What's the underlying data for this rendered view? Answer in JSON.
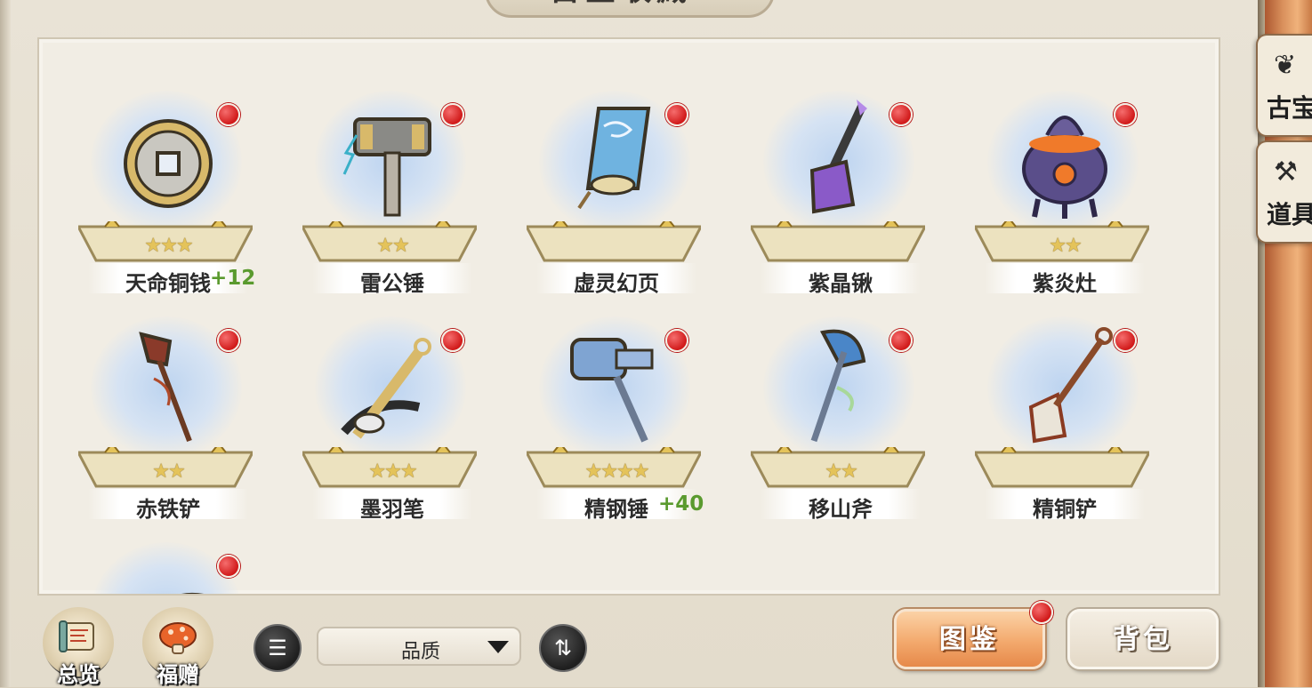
{
  "header": {
    "title": "古宝收藏"
  },
  "side_tabs": [
    {
      "label": "古宝",
      "icon": "scroll-icon"
    },
    {
      "label": "道具",
      "icon": "tool-icon"
    }
  ],
  "items": [
    {
      "name": "天命铜钱",
      "stars": 3,
      "bonus": "+12",
      "icon": "copper-coin-icon"
    },
    {
      "name": "雷公锤",
      "stars": 2,
      "bonus": "",
      "icon": "thunder-hammer-icon"
    },
    {
      "name": "虚灵幻页",
      "stars": 0,
      "bonus": "",
      "icon": "spirit-scroll-icon"
    },
    {
      "name": "紫晶锹",
      "stars": 0,
      "bonus": "",
      "icon": "amethyst-spade-icon"
    },
    {
      "name": "紫炎灶",
      "stars": 2,
      "bonus": "",
      "icon": "purple-stove-icon"
    },
    {
      "name": "赤铁铲",
      "stars": 2,
      "bonus": "",
      "icon": "red-iron-shovel-icon"
    },
    {
      "name": "墨羽笔",
      "stars": 3,
      "bonus": "",
      "icon": "ink-brush-icon"
    },
    {
      "name": "精钢锤",
      "stars": 4,
      "bonus": "+40",
      "icon": "steel-hammer-icon"
    },
    {
      "name": "移山斧",
      "stars": 2,
      "bonus": "",
      "icon": "mountain-axe-icon"
    },
    {
      "name": "精铜铲",
      "stars": 0,
      "bonus": "",
      "icon": "bronze-shovel-icon"
    },
    {
      "name": "",
      "stars": 0,
      "bonus": "",
      "icon": "vine-boomerang-icon"
    }
  ],
  "bottom": {
    "overview_label": "总览",
    "gift_label": "福赠",
    "sort_select_value": "品质",
    "codex_label": "图鉴",
    "backpack_label": "背包"
  },
  "colors": {
    "notify_red": "#d11a1a",
    "bonus_green": "#5a9a2e",
    "star_gold": "#e4c35a",
    "codex_orange": "#f3a96d"
  }
}
